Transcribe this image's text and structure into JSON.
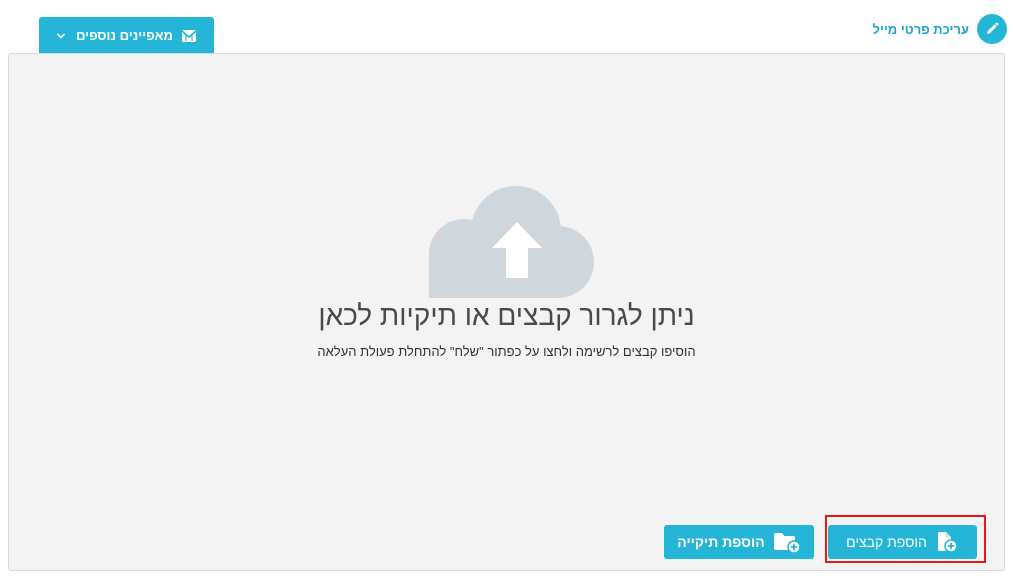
{
  "header": {
    "edit_label": "עריכת פרטי מייל",
    "edit_icon": "pencil-icon",
    "tab_label": "מאפיינים נוספים",
    "tab_icon": "mail-icon",
    "tab_chevron_icon": "chevron-down-icon"
  },
  "dropzone": {
    "icon": "cloud-upload-icon",
    "title": "ניתן לגרור קבצים או תיקיות לכאן",
    "subtitle": "הוסיפו קבצים לרשימה ולחצו על כפתור \"שלח\" להתחלת פעולת העלאה"
  },
  "actions": {
    "add_files_label": "הוספת קבצים",
    "add_files_icon": "file-add-icon",
    "add_folder_label": "הוספת תיקייה",
    "add_folder_icon": "folder-add-icon"
  },
  "colors": {
    "accent": "#25b6d7",
    "accent_text": "#1aa7c8",
    "cloud": "#cfd6dc",
    "highlight": "#e11b1b",
    "panel_bg": "#f3f3f3"
  }
}
